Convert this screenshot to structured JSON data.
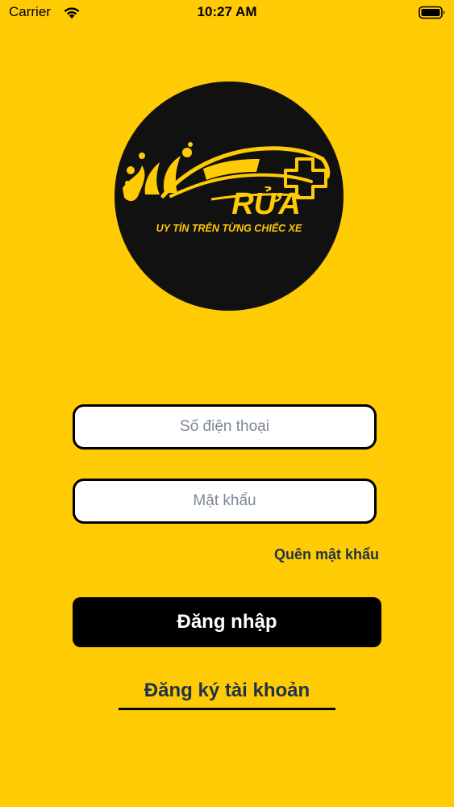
{
  "status_bar": {
    "carrier": "Carrier",
    "time": "10:27 AM",
    "wifi_icon": "wifi-icon",
    "battery_icon": "battery-icon"
  },
  "logo": {
    "brand_text": "RỬA",
    "tagline": "UY TÍN TRÊN TỪNG CHIẾC XE",
    "icon": "car-wash-logo"
  },
  "form": {
    "phone": {
      "placeholder": "Số điện thoại",
      "value": ""
    },
    "password": {
      "placeholder": "Mật khẩu",
      "value": ""
    },
    "forgot_label": "Quên mật khẩu",
    "login_label": "Đăng nhập",
    "register_label": "Đăng ký tài khoản"
  },
  "colors": {
    "background": "#FFCB05",
    "logo_background": "#111111",
    "accent_yellow": "#FFCB05",
    "button": "#000000",
    "link_text": "#1F3248"
  }
}
